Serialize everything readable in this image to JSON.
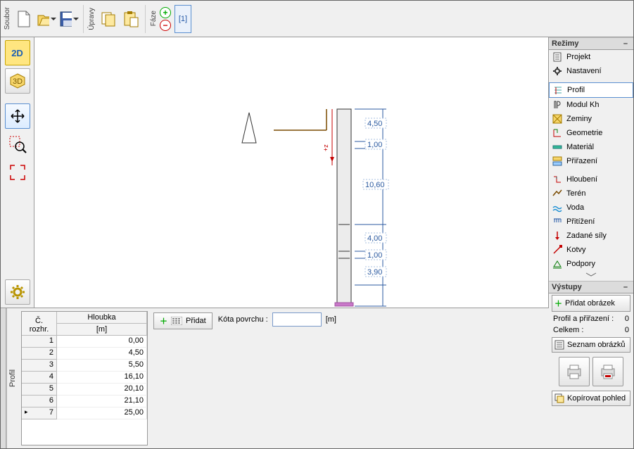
{
  "toolbar": {
    "group_soubor": "Soubor",
    "group_upravy": "Úpravy",
    "group_faze": "Fáze",
    "stage_label": "[1]"
  },
  "left_rail": {
    "btn_2d": "2D",
    "btn_3d": "3D"
  },
  "modes": {
    "head": "Režimy",
    "items": [
      "Projekt",
      "Nastavení",
      "Profil",
      "Modul Kh",
      "Zeminy",
      "Geometrie",
      "Materiál",
      "Přiřazení",
      "Hloubení",
      "Terén",
      "Voda",
      "Přitížení",
      "Zadané síly",
      "Kotvy",
      "Podpory"
    ]
  },
  "outputs": {
    "head": "Výstupy",
    "add_image": "Přidat obrázek",
    "profile_row_label": "Profil a přiřazení :",
    "profile_row_count": "0",
    "total_label": "Celkem :",
    "total_count": "0",
    "list_images": "Seznam obrázků",
    "copy_view": "Kopírovat pohled"
  },
  "drawing": {
    "dims": [
      "4,50",
      "1,00",
      "10,60",
      "4,00",
      "1,00",
      "3,90"
    ],
    "axis_label": "+z"
  },
  "bottom": {
    "tab_label": "Profil",
    "table_col1_l1": "Hloubka",
    "table_col1_l2": "[m]",
    "table_col0": "Č. rozhr.",
    "rows": [
      {
        "n": "1",
        "v": "0,00"
      },
      {
        "n": "2",
        "v": "4,50"
      },
      {
        "n": "3",
        "v": "5,50"
      },
      {
        "n": "4",
        "v": "16,10"
      },
      {
        "n": "5",
        "v": "20,10"
      },
      {
        "n": "6",
        "v": "21,10"
      },
      {
        "n": "7",
        "v": "25,00"
      }
    ],
    "add_label": "Přidat",
    "kota_label": "Kóta povrchu :",
    "kota_value": "",
    "kota_unit": "[m]"
  }
}
